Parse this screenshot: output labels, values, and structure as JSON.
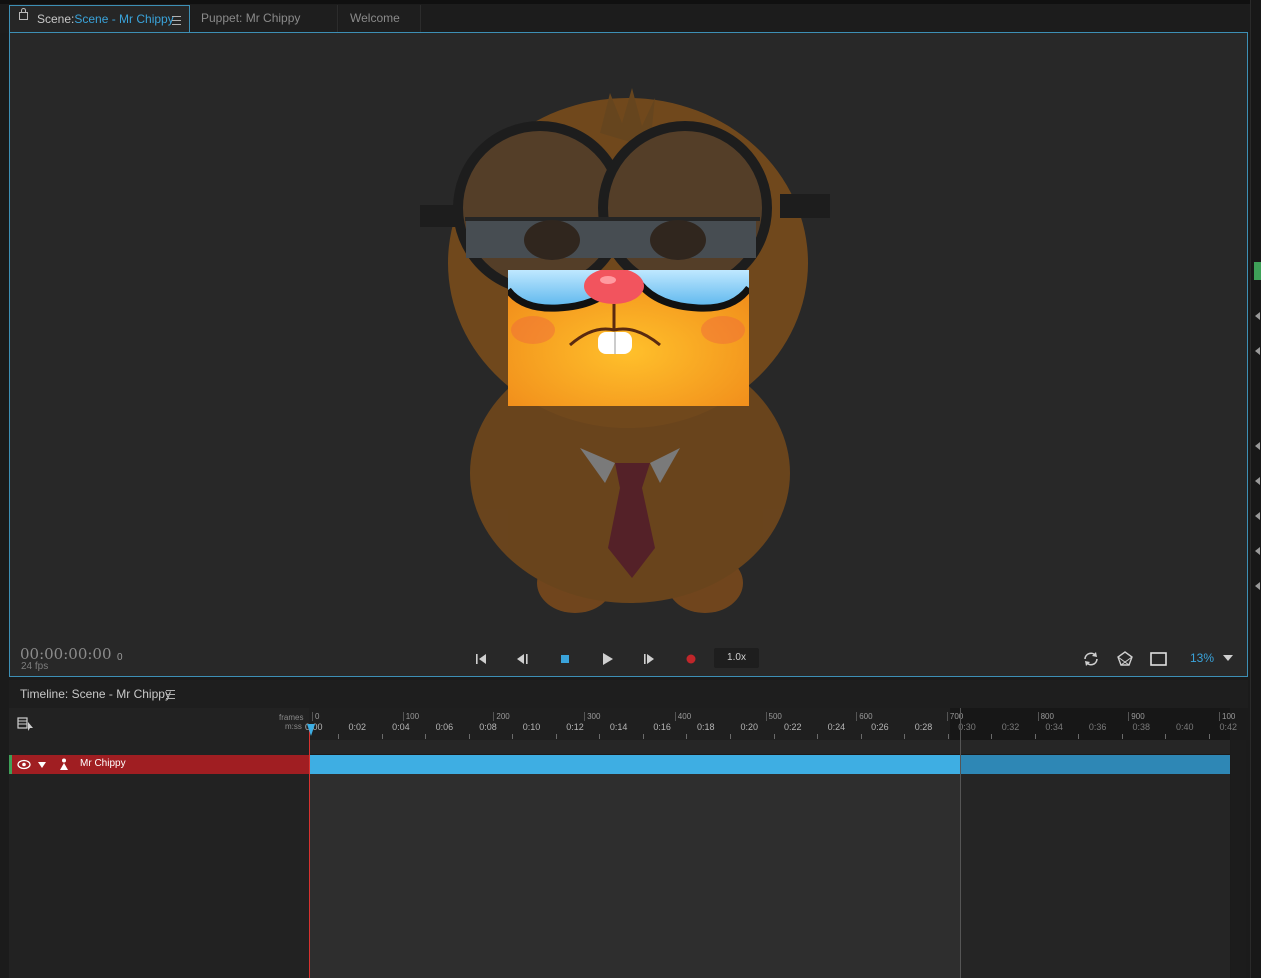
{
  "tabs": [
    {
      "prefix": "Scene:",
      "name": "Scene - Mr Chippy"
    },
    {
      "label": "Puppet: Mr Chippy"
    },
    {
      "label": "Welcome"
    }
  ],
  "scene": {
    "timecode": "00:00:00:00",
    "frame": "0",
    "fps": "24 fps",
    "speed": "1.0x",
    "zoom": "13%"
  },
  "timeline": {
    "title": "Timeline: Scene - Mr Chippy",
    "ruler_frames_label": "frames",
    "ruler_mss_label": "m:ss",
    "frame_ticks": [
      "0",
      "100",
      "200",
      "300",
      "400",
      "500",
      "600",
      "700",
      "800",
      "900",
      "100"
    ],
    "time_ticks": [
      "0:00",
      "0:02",
      "0:04",
      "0:06",
      "0:08",
      "0:10",
      "0:12",
      "0:14",
      "0:16",
      "0:18",
      "0:20",
      "0:22",
      "0:24",
      "0:26",
      "0:28",
      "0:30",
      "0:32",
      "0:34",
      "0:36",
      "0:38",
      "0:40",
      "0:42"
    ],
    "layers": [
      {
        "name": "Mr Chippy"
      }
    ]
  },
  "colors": {
    "accent": "#3aa3da",
    "layer_row": "#a01e22",
    "layer_bar": "#3eaee3",
    "playhead": "#d8322f",
    "record": "#c0262a"
  }
}
